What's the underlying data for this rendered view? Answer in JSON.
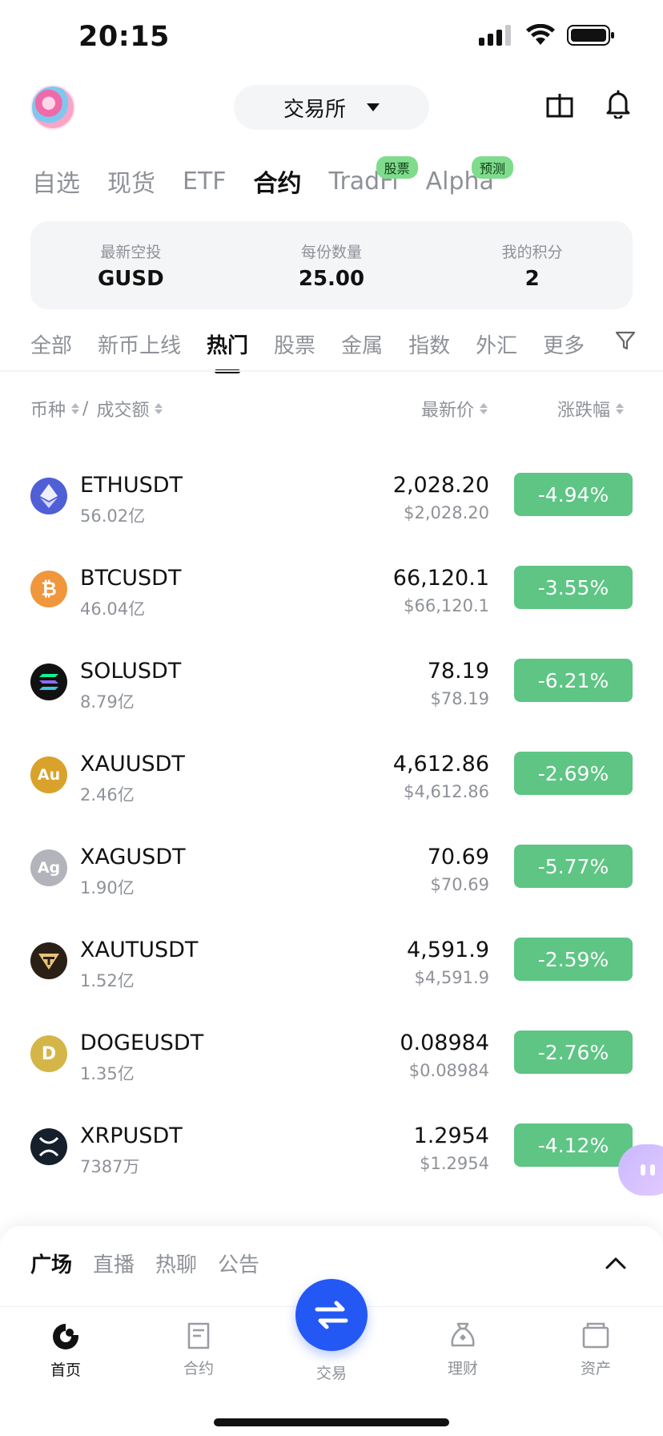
{
  "status_bar": {
    "time": "20:15"
  },
  "header": {
    "exchange_label": "交易所"
  },
  "market_tabs": [
    {
      "label": "自选",
      "active": false,
      "badge": ""
    },
    {
      "label": "现货",
      "active": false,
      "badge": ""
    },
    {
      "label": "ETF",
      "active": false,
      "badge": ""
    },
    {
      "label": "合约",
      "active": true,
      "badge": ""
    },
    {
      "label": "TradFi",
      "active": false,
      "badge": "股票"
    },
    {
      "label": "Alpha",
      "active": false,
      "badge": "预测"
    }
  ],
  "airdrop": [
    {
      "label": "最新空投",
      "value": "GUSD"
    },
    {
      "label": "每份数量",
      "value": "25.00"
    },
    {
      "label": "我的积分",
      "value": "2"
    }
  ],
  "category_tabs": [
    {
      "label": "全部",
      "active": false
    },
    {
      "label": "新币上线",
      "active": false
    },
    {
      "label": "热门",
      "active": true
    },
    {
      "label": "股票",
      "active": false
    },
    {
      "label": "金属",
      "active": false
    },
    {
      "label": "指数",
      "active": false
    },
    {
      "label": "外汇",
      "active": false
    },
    {
      "label": "更多",
      "active": false
    }
  ],
  "columns": {
    "coin": "币种",
    "separator": "/",
    "volume": "成交额",
    "price": "最新价",
    "change": "涨跌幅"
  },
  "rows": [
    {
      "symbol": "ETHUSDT",
      "volume": "56.02亿",
      "price": "2,028.20",
      "price_usd": "$2,028.20",
      "change": "-4.94%",
      "icon": "eth-icon",
      "icon_color": "#4f5fd6",
      "icon_text": ""
    },
    {
      "symbol": "BTCUSDT",
      "volume": "46.04亿",
      "price": "66,120.1",
      "price_usd": "$66,120.1",
      "change": "-3.55%",
      "icon": "btc-icon",
      "icon_color": "#f0963c",
      "icon_text": "₿"
    },
    {
      "symbol": "SOLUSDT",
      "volume": "8.79亿",
      "price": "78.19",
      "price_usd": "$78.19",
      "change": "-6.21%",
      "icon": "sol-icon",
      "icon_color": "#111111",
      "icon_text": ""
    },
    {
      "symbol": "XAUUSDT",
      "volume": "2.46亿",
      "price": "4,612.86",
      "price_usd": "$4,612.86",
      "change": "-2.69%",
      "icon": "gold-icon",
      "icon_color": "#d9a22a",
      "icon_text": "Au"
    },
    {
      "symbol": "XAGUSDT",
      "volume": "1.90亿",
      "price": "70.69",
      "price_usd": "$70.69",
      "change": "-5.77%",
      "icon": "silver-icon",
      "icon_color": "#b3b4bb",
      "icon_text": "Ag"
    },
    {
      "symbol": "XAUTUSDT",
      "volume": "1.52亿",
      "price": "4,591.9",
      "price_usd": "$4,591.9",
      "change": "-2.59%",
      "icon": "tether-gold-icon",
      "icon_color": "#2a2016",
      "icon_text": ""
    },
    {
      "symbol": "DOGEUSDT",
      "volume": "1.35亿",
      "price": "0.08984",
      "price_usd": "$0.08984",
      "change": "-2.76%",
      "icon": "doge-icon",
      "icon_color": "#d4b648",
      "icon_text": "D"
    },
    {
      "symbol": "XRPUSDT",
      "volume": "7387万",
      "price": "1.2954",
      "price_usd": "$1.2954",
      "change": "-4.12%",
      "icon": "xrp-icon",
      "icon_color": "#16202c",
      "icon_text": ""
    }
  ],
  "colors": {
    "change_negative": "#5ec584",
    "trade_button": "#2458f5"
  },
  "community_tabs": [
    {
      "label": "广场",
      "active": true
    },
    {
      "label": "直播",
      "active": false
    },
    {
      "label": "热聊",
      "active": false
    },
    {
      "label": "公告",
      "active": false
    }
  ],
  "bottom_nav": [
    {
      "label": "首页",
      "icon": "home-icon",
      "active": true
    },
    {
      "label": "合约",
      "icon": "contract-icon",
      "active": false
    },
    {
      "label": "交易",
      "icon": "swap-icon",
      "active": false
    },
    {
      "label": "理财",
      "icon": "finance-icon",
      "active": false
    },
    {
      "label": "资产",
      "icon": "wallet-icon",
      "active": false
    }
  ]
}
